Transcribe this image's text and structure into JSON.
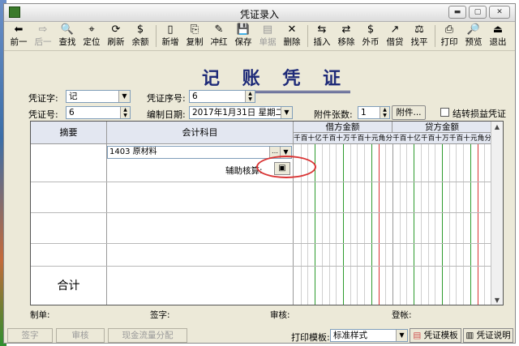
{
  "window": {
    "title": "凭证录入"
  },
  "toolbar": {
    "items": [
      {
        "label": "前一",
        "icon": "arrow-left-icon",
        "glyph": "⬅"
      },
      {
        "label": "后一",
        "icon": "arrow-right-icon",
        "glyph": "⇨"
      },
      {
        "label": "查找",
        "icon": "find-icon",
        "glyph": "🔍"
      },
      {
        "label": "定位",
        "icon": "locate-icon",
        "glyph": "⌖"
      },
      {
        "label": "刷新",
        "icon": "refresh-icon",
        "glyph": "⟳"
      },
      {
        "label": "余额",
        "icon": "balance-icon",
        "glyph": "$"
      },
      {
        "label": "新增",
        "icon": "new-icon",
        "glyph": "▯"
      },
      {
        "label": "复制",
        "icon": "copy-icon",
        "glyph": "⎘"
      },
      {
        "label": "冲红",
        "icon": "reverse-icon",
        "glyph": "✎"
      },
      {
        "label": "保存",
        "icon": "save-icon",
        "glyph": "💾"
      },
      {
        "label": "单据",
        "icon": "document-icon",
        "glyph": "▤"
      },
      {
        "label": "删除",
        "icon": "delete-icon",
        "glyph": "✕"
      },
      {
        "label": "插入",
        "icon": "insert-icon",
        "glyph": "⇆"
      },
      {
        "label": "移除",
        "icon": "remove-icon",
        "glyph": "⇄"
      },
      {
        "label": "外币",
        "icon": "foreign-currency-icon",
        "glyph": "$"
      },
      {
        "label": "借贷",
        "icon": "debit-credit-icon",
        "glyph": "↗"
      },
      {
        "label": "找平",
        "icon": "balance-scale-icon",
        "glyph": "⚖"
      },
      {
        "label": "打印",
        "icon": "print-icon",
        "glyph": "⎙"
      },
      {
        "label": "预览",
        "icon": "preview-icon",
        "glyph": "🔎"
      },
      {
        "label": "退出",
        "icon": "exit-icon",
        "glyph": "⏏"
      }
    ]
  },
  "voucher": {
    "heading": "记 账 凭 证",
    "type_label": "凭证字:",
    "type_value": "记",
    "seq_label": "凭证序号:",
    "seq_value": "6",
    "no_label": "凭证号:",
    "no_value": "6",
    "date_label": "编制日期:",
    "date_value": "2017年1月31日 星期二",
    "attach_label": "附件张数:",
    "attach_value": "1",
    "attach_button": "附件...",
    "transfer_label": "结转损益凭证"
  },
  "grid": {
    "col_summary": "摘要",
    "col_account": "会计科目",
    "col_debit": "借方金额",
    "col_credit": "贷方金额",
    "digits": [
      "千",
      "百",
      "十",
      "亿",
      "千",
      "百",
      "十",
      "万",
      "千",
      "百",
      "十",
      "元",
      "角",
      "分"
    ],
    "row1_account": "1403  原材料",
    "aux_label": "辅助核算:",
    "total_label": "合计"
  },
  "signatures": {
    "maker": "制单:",
    "signer": "签字:",
    "auditor": "审核:",
    "bookkeeper": "登帐:"
  },
  "bottom": {
    "sign_btn": "签字",
    "audit_btn": "审核",
    "cashflow_btn": "现金流量分配",
    "template_label": "打印模板:",
    "template_value": "标准样式",
    "template_btn": "凭证模板",
    "help_btn": "凭证说明"
  },
  "colors": {
    "heading": "#1e2a78",
    "grid_green": "#2e9b2e",
    "grid_red": "#d93434",
    "annotation": "#d93434"
  }
}
